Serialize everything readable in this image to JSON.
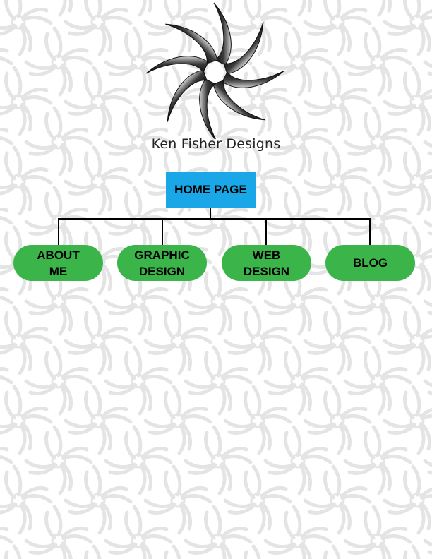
{
  "brand": {
    "name": "Ken Fisher Designs",
    "logo_icon": "pinwheel-star-logo"
  },
  "sitemap": {
    "home": {
      "label": "HOME PAGE"
    },
    "pages": [
      {
        "line1": "ABOUT",
        "line2": "ME"
      },
      {
        "line1": "GRAPHIC",
        "line2": "DESIGN"
      },
      {
        "line1": "WEB",
        "line2": "DESIGN"
      },
      {
        "line1": "BLOG",
        "line2": ""
      }
    ]
  },
  "colors": {
    "home_fill": "#1aa7e8",
    "page_fill": "#3bb54a",
    "pattern": "#e6e6e6"
  }
}
